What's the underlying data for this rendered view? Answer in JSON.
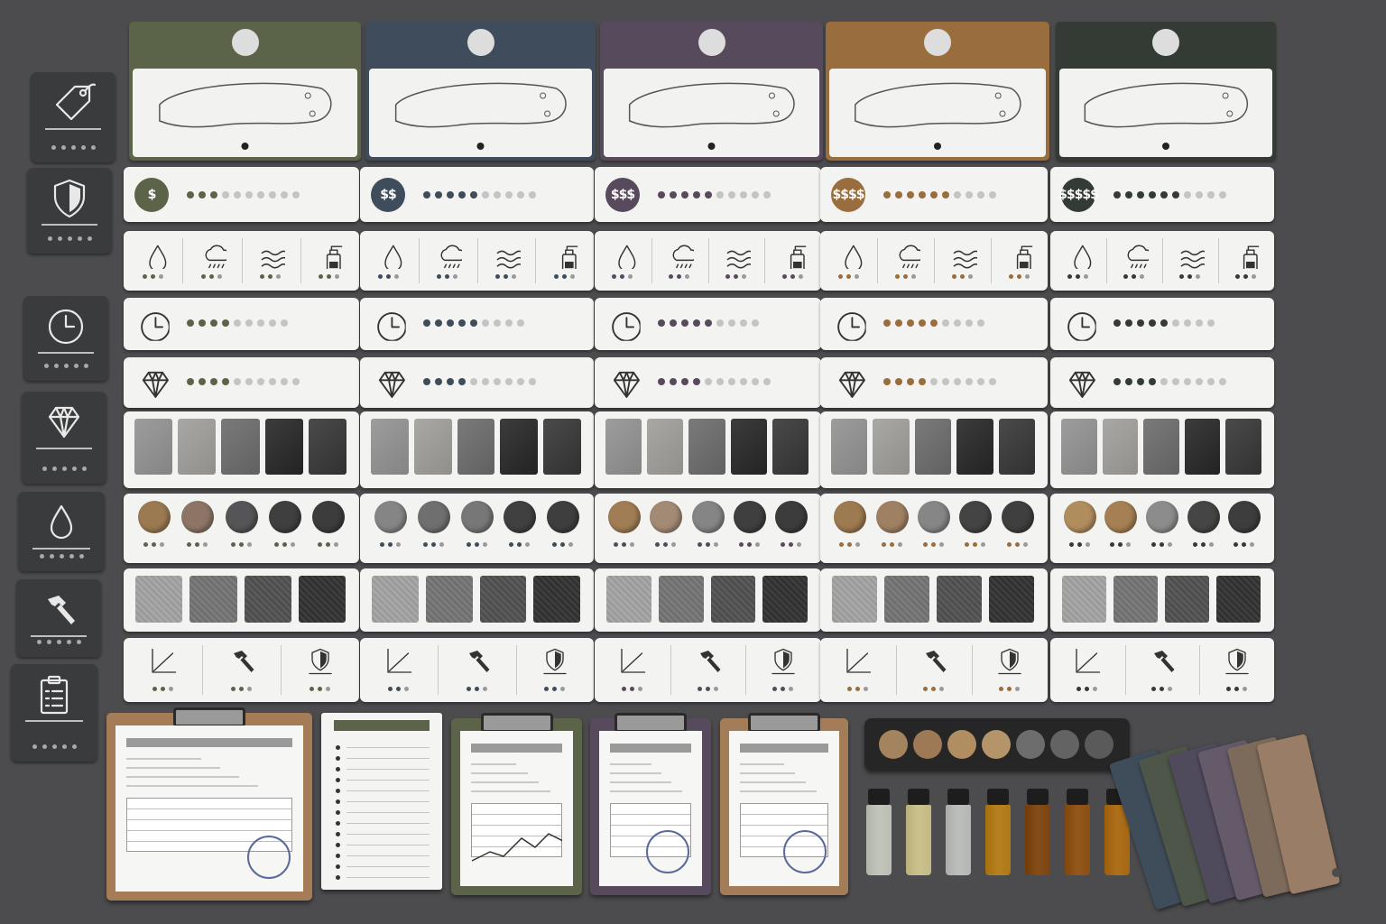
{
  "sidebar": {
    "tiles": [
      {
        "icon": "price-tag-icon"
      },
      {
        "icon": "shield-icon"
      },
      {
        "icon": "clock-icon"
      },
      {
        "icon": "diamond-icon"
      },
      {
        "icon": "water-drop-icon"
      },
      {
        "icon": "hammer-icon"
      },
      {
        "icon": "clipboard-checklist-icon"
      }
    ]
  },
  "columns": [
    {
      "accent": "#5b6449",
      "price": "$"
    },
    {
      "accent": "#3e4c5c",
      "price": "$$"
    },
    {
      "accent": "#574a5c",
      "price": "$$$"
    },
    {
      "accent": "#9a6d3e",
      "price": "$$$$"
    },
    {
      "accent": "#343a34",
      "price": "$$$$$"
    }
  ],
  "rows": {
    "environment_icons": [
      "water-drop-icon",
      "rain-cloud-icon",
      "waves-icon",
      "spray-bottle-icon"
    ],
    "performance_icons": [
      "graph-axes-icon",
      "hammer-icon",
      "shield-gauge-icon"
    ],
    "time_icon": "clock-icon",
    "gem_icon": "diamond-icon"
  },
  "colors": {
    "background": "#4c4c4e",
    "card": "#f3f3f1",
    "tile": "#3a3b3c",
    "dot_inactive": "#c4c4c4"
  }
}
